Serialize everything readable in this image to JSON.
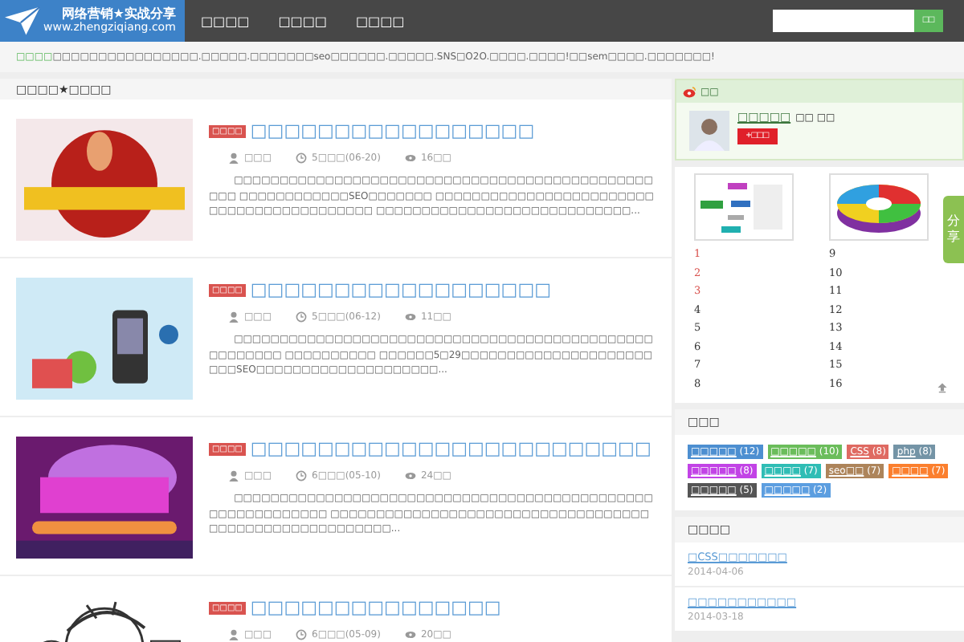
{
  "logo": {
    "title": "网络营销★实战分享",
    "url": "www.zhengziqiang.com"
  },
  "nav": [
    {
      "label": "□□□□"
    },
    {
      "label": "□□□□"
    },
    {
      "label": "□□□□"
    }
  ],
  "search": {
    "button": "□□"
  },
  "notice": {
    "label": "□□□□",
    "text": "□□□□□□□□□□□□□□□□.□□□□□.□□□□□□□seo□□□□□□.□□□□□.SNS□O2O.□□□□.□□□□!□□sem□□□□.□□□□□□□!"
  },
  "breadcrumb": "□□□□★□□□□",
  "posts": [
    {
      "tag": "□□□□",
      "title": "□□□□□□□□□□□□□□□□□",
      "author": "□□□",
      "time": "5□□□(06-20)",
      "views": "16□□",
      "excerpt": "□□□□□□□□□□□□□□□□□□□□□□□□□□□□□□□□□□□□□□□□□□□□□□□□□ □□□□□□□□□□□□SEO□□□□□□□ □□□□□□□□□□□□□□□□□□□□□□□□□□□□□□□□□□□□□□□□□□ □□□□□□□□□□□□□□□□□□□□□□□□□□□□..."
    },
    {
      "tag": "□□□□",
      "title": "□□□□□□□□□□□□□□□□□□",
      "author": "□□□",
      "time": "5□□□(06-12)",
      "views": "11□□",
      "excerpt": "□□□□□□□□□□□□□□□□□□□□□□□□□□□□□□□□□□□□□□□□□□□□□□□□□□□□□□ □□□□□□□□□□ □□□□□□5□29□□□□□□□□□□□□□□□□□□□□□□□□SEO□□□□□□□□□□□□□□□□□□□□..."
    },
    {
      "tag": "□□□□",
      "title": "□□□□□□□□□□□□□□□□□□□□□□□□",
      "author": "□□□",
      "time": "6□□□(05-10)",
      "views": "24□□",
      "excerpt": "□□□□□□□□□□□□□□□□□□□□□□□□□□□□□□□□□□□□□□□□□□□□□□□□□□□□□□□□□□□ □□□□□□□□□□□□□□□□□□□□□□□□□□□□□□□□□□□□□□□□□□□□□□□□□□□□□□□..."
    },
    {
      "tag": "□□□□",
      "title": "□□□□□□□□□□□□□□□",
      "author": "□□□",
      "time": "6□□□(05-09)",
      "views": "20□□"
    }
  ],
  "weibo": {
    "title": "□□",
    "name": "□□□□□",
    "meta": "□□ □□",
    "follow": "+□□□"
  },
  "ranking": {
    "left": [
      {
        "n": "1",
        "hot": true
      },
      {
        "n": "2",
        "hot": true
      },
      {
        "n": "3",
        "hot": true
      },
      {
        "n": "4",
        "hot": false
      },
      {
        "n": "5",
        "hot": false
      },
      {
        "n": "6",
        "hot": false
      },
      {
        "n": "7",
        "hot": false
      },
      {
        "n": "8",
        "hot": false
      }
    ],
    "right": [
      {
        "n": "9",
        "hot": false
      },
      {
        "n": "10",
        "hot": false
      },
      {
        "n": "11",
        "hot": false
      },
      {
        "n": "12",
        "hot": false
      },
      {
        "n": "13",
        "hot": false
      },
      {
        "n": "14",
        "hot": false
      },
      {
        "n": "15",
        "hot": false
      },
      {
        "n": "16",
        "hot": false
      }
    ]
  },
  "share": "分享",
  "tags": {
    "title": "□□□",
    "items": [
      {
        "label": "□□□□□",
        "count": "(12)",
        "color": "#4d8fd1"
      },
      {
        "label": "□□□□□",
        "count": "(10)",
        "color": "#6bbd5b"
      },
      {
        "label": "CSS",
        "count": "(8)",
        "color": "#df6a62"
      },
      {
        "label": "php",
        "count": "(8)",
        "color": "#7494a6"
      },
      {
        "label": "□□□□□",
        "count": "(8)",
        "color": "#c243e6"
      },
      {
        "label": "□□□□",
        "count": "(7)",
        "color": "#2fbdb5"
      },
      {
        "label": "seo□□",
        "count": "(7)",
        "color": "#ad845a"
      },
      {
        "label": "□□□□",
        "count": "(7)",
        "color": "#fb7f2e"
      },
      {
        "label": "□□□□□",
        "count": "(5)",
        "color": "#555555"
      },
      {
        "label": "□□□□□",
        "count": "(2)",
        "color": "#5c9ee0"
      }
    ]
  },
  "recent": {
    "title": "□□□□",
    "items": [
      {
        "title": "□CSS□□□□□□□",
        "date": "2014-04-06"
      },
      {
        "title": "□□□□□□□□□□□",
        "date": "2014-03-18"
      }
    ]
  }
}
